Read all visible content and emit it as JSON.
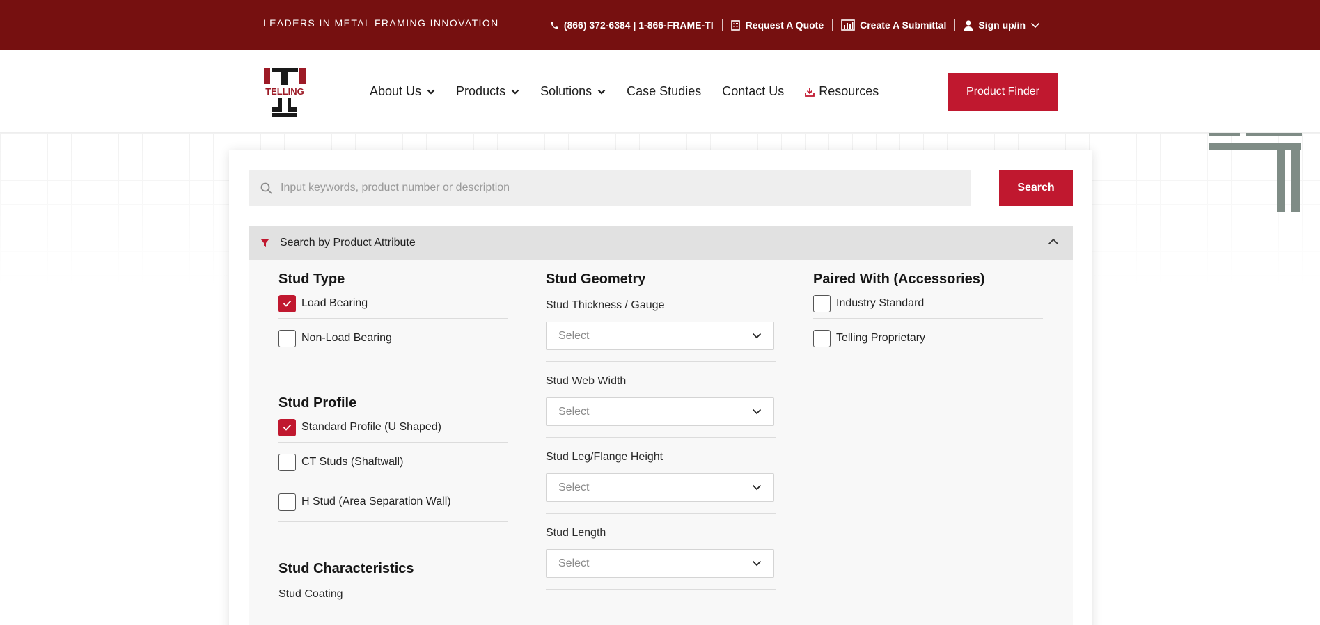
{
  "topbar": {
    "tagline": "LEADERS IN METAL FRAMING INNOVATION",
    "phone": "(866) 372-6384 | 1-866-FRAME-TI",
    "quote": "Request A Quote",
    "submittal": "Create A Submittal",
    "signin": "Sign up/in"
  },
  "logo": {
    "text": "TELLING"
  },
  "nav": {
    "about": "About Us",
    "products": "Products",
    "solutions": "Solutions",
    "case_studies": "Case Studies",
    "contact": "Contact Us",
    "resources": "Resources",
    "finder": "Product Finder"
  },
  "search": {
    "placeholder": "Input keywords, product number or description",
    "button": "Search"
  },
  "attributes": {
    "header": "Search by Product Attribute",
    "stud_type": {
      "title": "Stud Type",
      "options": [
        {
          "label": "Load Bearing",
          "checked": true
        },
        {
          "label": "Non-Load Bearing",
          "checked": false
        }
      ]
    },
    "stud_profile": {
      "title": "Stud Profile",
      "options": [
        {
          "label": "Standard Profile (U Shaped)",
          "checked": true
        },
        {
          "label": "CT Studs (Shaftwall)",
          "checked": false
        },
        {
          "label": "H Stud (Area Separation Wall)",
          "checked": false
        }
      ]
    },
    "stud_characteristics": {
      "title": "Stud Characteristics",
      "coating_label": "Stud Coating"
    },
    "stud_geometry": {
      "title": "Stud Geometry",
      "fields": [
        {
          "label": "Stud Thickness / Gauge",
          "value": "Select"
        },
        {
          "label": "Stud Web Width",
          "value": "Select"
        },
        {
          "label": "Stud Leg/Flange Height",
          "value": "Select"
        },
        {
          "label": "Stud Length",
          "value": "Select"
        }
      ]
    },
    "paired_with": {
      "title": "Paired With (Accessories)",
      "options": [
        {
          "label": "Industry Standard",
          "checked": false
        },
        {
          "label": "Telling Proprietary",
          "checked": false
        }
      ]
    }
  },
  "colors": {
    "topbar": "#761010",
    "accent": "#c0182f",
    "deco_grey": "#7f8c86"
  }
}
